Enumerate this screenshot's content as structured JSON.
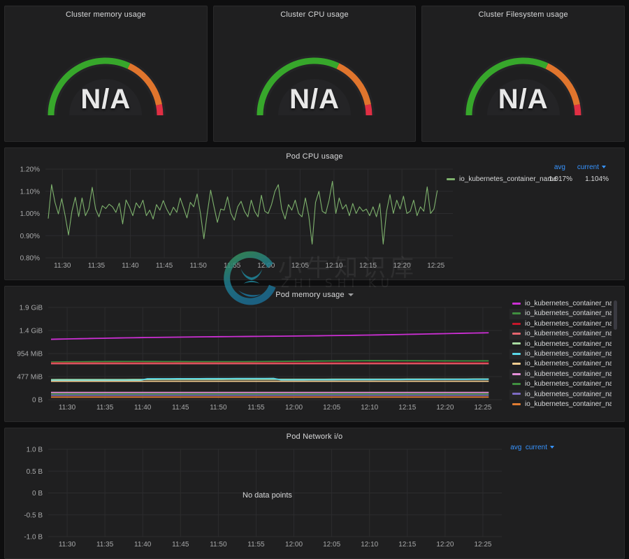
{
  "gauges": [
    {
      "title": "Cluster memory usage",
      "value": "N/A"
    },
    {
      "title": "Cluster CPU usage",
      "value": "N/A"
    },
    {
      "title": "Cluster Filesystem usage",
      "value": "N/A"
    }
  ],
  "gauge_colors": {
    "green": "#37a72b",
    "orange": "#e0752d",
    "red": "#e02f44",
    "track": "#242426"
  },
  "cpu_panel": {
    "title": "Pod CPU usage",
    "y_ticks": [
      "1.20%",
      "1.10%",
      "1.00%",
      "0.90%",
      "0.80%"
    ],
    "x_ticks": [
      "11:30",
      "11:35",
      "11:40",
      "11:45",
      "11:50",
      "11:55",
      "12:00",
      "12:05",
      "12:10",
      "12:15",
      "12:20",
      "12:25"
    ],
    "legend": {
      "col_avg": "avg",
      "col_current": "current",
      "series_name": "io_kubernetes_container_name",
      "avg": "1.017%",
      "current": "1.104%",
      "color": "#7eb26d"
    }
  },
  "memory_panel": {
    "title": "Pod memory usage",
    "y_ticks": [
      "1.9 GiB",
      "1.4 GiB",
      "954 MiB",
      "477 MiB",
      "0 B"
    ],
    "x_ticks": [
      "11:30",
      "11:35",
      "11:40",
      "11:45",
      "11:50",
      "11:55",
      "12:00",
      "12:05",
      "12:10",
      "12:15",
      "12:20",
      "12:25"
    ],
    "legend_items": [
      {
        "label": "io_kubernetes_container_name",
        "color": "#cc2fd4"
      },
      {
        "label": "io_kubernetes_container_name",
        "color": "#3f8f3f"
      },
      {
        "label": "io_kubernetes_container_name",
        "color": "#c4162a"
      },
      {
        "label": "io_kubernetes_container_name",
        "color": "#e5656f"
      },
      {
        "label": "io_kubernetes_container_name",
        "color": "#a8dba0"
      },
      {
        "label": "io_kubernetes_container_name",
        "color": "#5ad8e8"
      },
      {
        "label": "io_kubernetes_container_name",
        "color": "#f2cc8f"
      },
      {
        "label": "io_kubernetes_container_name",
        "color": "#e58fd8"
      },
      {
        "label": "io_kubernetes_container_name",
        "color": "#3f8f3f"
      },
      {
        "label": "io_kubernetes_container_name",
        "color": "#7d6bc4"
      },
      {
        "label": "io_kubernetes_container_name",
        "color": "#e07c32"
      }
    ]
  },
  "network_panel": {
    "title": "Pod Network i/o",
    "y_ticks": [
      "1.0 B",
      "0.5 B",
      "0 B",
      "-0.5 B",
      "-1.0 B"
    ],
    "x_ticks": [
      "11:30",
      "11:35",
      "11:40",
      "11:45",
      "11:50",
      "11:55",
      "12:00",
      "12:05",
      "12:10",
      "12:15",
      "12:20",
      "12:25"
    ],
    "no_data": "No data points",
    "legend": {
      "col_avg": "avg",
      "col_current": "current"
    }
  },
  "watermark": {
    "cn": "小牛知识库",
    "en": "ZHI SHI KU"
  },
  "chart_data": [
    {
      "type": "gauge",
      "title": "Cluster memory usage",
      "value": null,
      "display": "N/A",
      "thresholds": [
        {
          "from": 0,
          "to": 0.72,
          "color": "#37a72b"
        },
        {
          "from": 0.72,
          "to": 0.93,
          "color": "#e0752d"
        },
        {
          "from": 0.93,
          "to": 1.0,
          "color": "#e02f44"
        }
      ]
    },
    {
      "type": "gauge",
      "title": "Cluster CPU usage",
      "value": null,
      "display": "N/A",
      "thresholds": [
        {
          "from": 0,
          "to": 0.72,
          "color": "#37a72b"
        },
        {
          "from": 0.72,
          "to": 0.93,
          "color": "#e0752d"
        },
        {
          "from": 0.93,
          "to": 1.0,
          "color": "#e02f44"
        }
      ]
    },
    {
      "type": "gauge",
      "title": "Cluster Filesystem usage",
      "value": null,
      "display": "N/A",
      "thresholds": [
        {
          "from": 0,
          "to": 0.72,
          "color": "#37a72b"
        },
        {
          "from": 0.72,
          "to": 0.93,
          "color": "#e0752d"
        },
        {
          "from": 0.93,
          "to": 1.0,
          "color": "#e02f44"
        }
      ]
    },
    {
      "type": "line",
      "title": "Pod CPU usage",
      "xlabel": "",
      "ylabel": "",
      "ylim": [
        0.8,
        1.2
      ],
      "ytick_values": [
        0.8,
        0.9,
        1.0,
        1.1,
        1.2
      ],
      "ytick_labels": [
        "0.80%",
        "0.90%",
        "1.00%",
        "1.10%",
        "1.20%"
      ],
      "xtick_labels": [
        "11:30",
        "11:35",
        "11:40",
        "11:45",
        "11:50",
        "11:55",
        "12:00",
        "12:05",
        "12:10",
        "12:15",
        "12:20",
        "12:25"
      ],
      "grid": true,
      "legend_position": "right",
      "series": [
        {
          "name": "io_kubernetes_container_name",
          "color": "#7eb26d",
          "avg": 1.017,
          "current": 1.104,
          "values": [
            0.977,
            1.13,
            1.05,
            0.998,
            1.067,
            0.99,
            0.903,
            1.01,
            1.073,
            0.986,
            1.07,
            0.99,
            1.022,
            1.118,
            1.02,
            0.985,
            1.035,
            1.022,
            1.042,
            1.03,
            1.005,
            1.047,
            0.953,
            1.061,
            1.03,
            0.99,
            1.048,
            1.025,
            1.06,
            0.99,
            1.015,
            0.975,
            1.04,
            1.015,
            1.058,
            1.02,
            0.992,
            1.028,
            1.005,
            1.07,
            1.025,
            0.98,
            1.05,
            1.03,
            1.088,
            1.0,
            0.886,
            1.0,
            1.105,
            1.03,
            0.96,
            1.02,
            1.015,
            1.075,
            1.0,
            0.97,
            1.03,
            1.055,
            1.01,
            0.985,
            1.06,
            1.01,
            0.985,
            1.082,
            1.01,
            1.0,
            1.04,
            1.1,
            1.13,
            1.02,
            0.975,
            1.04,
            1.015,
            1.06,
            1.0,
            0.985,
            1.07,
            0.99,
            0.862,
            1.05,
            1.1,
            1.01,
            1.0,
            1.06,
            1.145,
            1.0,
            1.07,
            1.02,
            1.04,
            0.99,
            1.045,
            1.0,
            1.03,
            1.01,
            1.02,
            0.99,
            1.03,
            0.985,
            1.045,
            0.862,
            1.01,
            1.085,
            1.0,
            1.06,
            1.02,
            1.078,
            1.0,
            1.01,
            1.06,
            0.99,
            1.03,
            1.01,
            1.12,
            1.0,
            1.02,
            1.104
          ]
        }
      ]
    },
    {
      "type": "line",
      "title": "Pod memory usage",
      "xlabel": "",
      "ylabel": "",
      "ylim_bytes": [
        0,
        2040109465
      ],
      "ytick_labels": [
        "0 B",
        "477 MiB",
        "954 MiB",
        "1.4 GiB",
        "1.9 GiB"
      ],
      "xtick_labels": [
        "11:30",
        "11:35",
        "11:40",
        "11:45",
        "11:50",
        "11:55",
        "12:00",
        "12:05",
        "12:10",
        "12:15",
        "12:20",
        "12:25"
      ],
      "grid": true,
      "legend_position": "right",
      "series": [
        {
          "name": "io_kubernetes_container_name",
          "color": "#cc2fd4",
          "start_label": "1.26 GiB",
          "end_label": "1.39 GiB",
          "trend": "rising"
        },
        {
          "name": "io_kubernetes_container_name",
          "color": "#3f8f3f",
          "start_label": "772 MiB",
          "end_label": "800 MiB",
          "trend": "flat-rising"
        },
        {
          "name": "io_kubernetes_container_name",
          "color": "#c4162a",
          "start_label": "768 MiB",
          "end_label": "768 MiB",
          "trend": "flat"
        },
        {
          "name": "io_kubernetes_container_name",
          "color": "#e5656f",
          "start_label": "760 MiB",
          "end_label": "760 MiB",
          "trend": "flat"
        },
        {
          "name": "io_kubernetes_container_name",
          "color": "#a8dba0",
          "start_label": "420 MiB",
          "end_label": "430 MiB",
          "trend": "flat"
        },
        {
          "name": "io_kubernetes_container_name",
          "color": "#5ad8e8",
          "start_label": "405 MiB",
          "end_label": "430 MiB",
          "trend": "step"
        },
        {
          "name": "io_kubernetes_container_name",
          "color": "#f2cc8f",
          "start_label": "395 MiB",
          "end_label": "395 MiB",
          "trend": "flat"
        },
        {
          "name": "io_kubernetes_container_name",
          "color": "#e58fd8",
          "start_label": "150 MiB",
          "end_label": "150 MiB",
          "trend": "flat"
        },
        {
          "name": "io_kubernetes_container_name",
          "color": "#3f8f3f",
          "start_label": "120 MiB",
          "end_label": "120 MiB",
          "trend": "flat"
        },
        {
          "name": "io_kubernetes_container_name",
          "color": "#7d6bc4",
          "start_label": "100 MiB",
          "end_label": "100 MiB",
          "trend": "flat"
        },
        {
          "name": "io_kubernetes_container_name",
          "color": "#e07c32",
          "start_label": "60 MiB",
          "end_label": "60 MiB",
          "trend": "flat"
        }
      ]
    },
    {
      "type": "line",
      "title": "Pod Network i/o",
      "xlabel": "",
      "ylabel": "",
      "ylim": [
        -1.0,
        1.0
      ],
      "ytick_values": [
        -1.0,
        -0.5,
        0,
        0.5,
        1.0
      ],
      "ytick_labels": [
        "-1.0 B",
        "-0.5 B",
        "0 B",
        "0.5 B",
        "1.0 B"
      ],
      "xtick_labels": [
        "11:30",
        "11:35",
        "11:40",
        "11:45",
        "11:50",
        "11:55",
        "12:00",
        "12:05",
        "12:10",
        "12:15",
        "12:20",
        "12:25"
      ],
      "grid": true,
      "legend_position": "right",
      "series": [],
      "annotation": "No data points"
    }
  ]
}
